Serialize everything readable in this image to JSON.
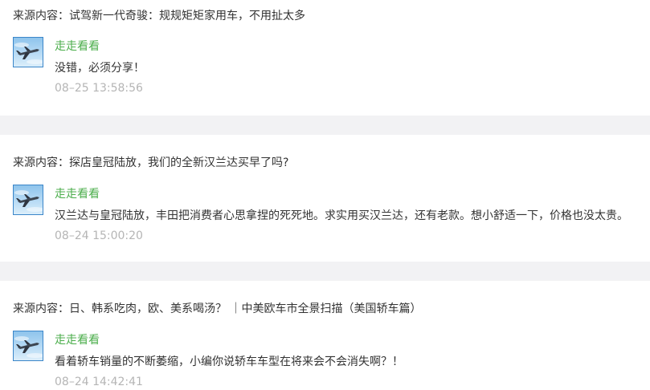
{
  "colors": {
    "author": "#4cae4c",
    "text": "#333333",
    "time": "#b5b5b5",
    "separator": "#f2f2f4",
    "avatar_border": "#3b86c9"
  },
  "items": [
    {
      "source_label": "来源内容：",
      "source_title": "试驾新一代奇骏：规规矩矩家用车，不用扯太多",
      "avatar_icon": "airplane-avatar-icon",
      "author": "走走看看",
      "comment": "没错，必须分享！",
      "time": "08–25 13:58:56"
    },
    {
      "source_label": "来源内容：",
      "source_title": "探店皇冠陆放，我们的全新汉兰达买早了吗?",
      "avatar_icon": "airplane-avatar-icon",
      "author": "走走看看",
      "comment": "汉兰达与皇冠陆放，丰田把消费者心思拿捏的死死地。求实用买汉兰达，还有老款。想小舒适一下，价格也没太贵。",
      "time": "08–24 15:00:20"
    },
    {
      "source_label": "来源内容：",
      "source_title": "日、韩系吃肉，欧、美系喝汤？ ｜中美欧车市全景扫描（美国轿车篇）",
      "avatar_icon": "airplane-avatar-icon",
      "author": "走走看看",
      "comment": "看着轿车销量的不断萎缩，小编你说轿车车型在将来会不会消失啊？！",
      "time": "08–24 14:42:41"
    }
  ]
}
